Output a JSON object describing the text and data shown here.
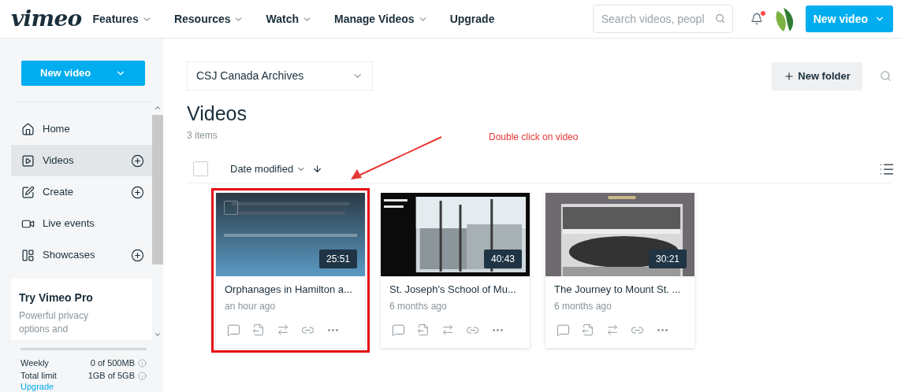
{
  "header": {
    "logo": "vimeo",
    "menu": [
      {
        "label": "Features",
        "dropdown": true
      },
      {
        "label": "Resources",
        "dropdown": true
      },
      {
        "label": "Watch",
        "dropdown": true
      },
      {
        "label": "Manage Videos",
        "dropdown": true
      },
      {
        "label": "Upgrade",
        "dropdown": false
      }
    ],
    "search": {
      "placeholder": "Search videos, peopl"
    },
    "notification": true,
    "new_video": "New video"
  },
  "sidebar": {
    "new_video": "New video",
    "items": [
      {
        "label": "Home",
        "selected": false,
        "add": false
      },
      {
        "label": "Videos",
        "selected": true,
        "add": true
      },
      {
        "label": "Create",
        "selected": false,
        "add": true
      },
      {
        "label": "Live events",
        "selected": false,
        "add": false
      },
      {
        "label": "Showcases",
        "selected": false,
        "add": true
      }
    ],
    "promo": {
      "title": "Try Vimeo Pro",
      "text": "Powerful privacy options and"
    },
    "storage": [
      {
        "label": "Weekly",
        "value": "0 of 500MB",
        "level": 0
      },
      {
        "label": "Total limit",
        "value": "1GB of 5GB"
      }
    ],
    "upgrade": "Upgrade"
  },
  "main": {
    "folder": "CSJ Canada Archives",
    "new_folder": "New folder",
    "title": "Videos",
    "count": "3 items",
    "sort": "Date modified",
    "all_selected": false,
    "annotation": "Double click on video",
    "videos": [
      {
        "title": "Orphanages in Hamilton a...",
        "time": "an hour ago",
        "duration": "25:51",
        "hovered": true,
        "selected": false,
        "highlighted": true
      },
      {
        "title": "St. Joseph's School of Mu...",
        "time": "6 months ago",
        "duration": "40:43",
        "hovered": false,
        "selected": false,
        "highlighted": false
      },
      {
        "title": "The Journey to Mount St. ...",
        "time": "6 months ago",
        "duration": "30:21",
        "hovered": false,
        "selected": false,
        "highlighted": false
      }
    ]
  }
}
